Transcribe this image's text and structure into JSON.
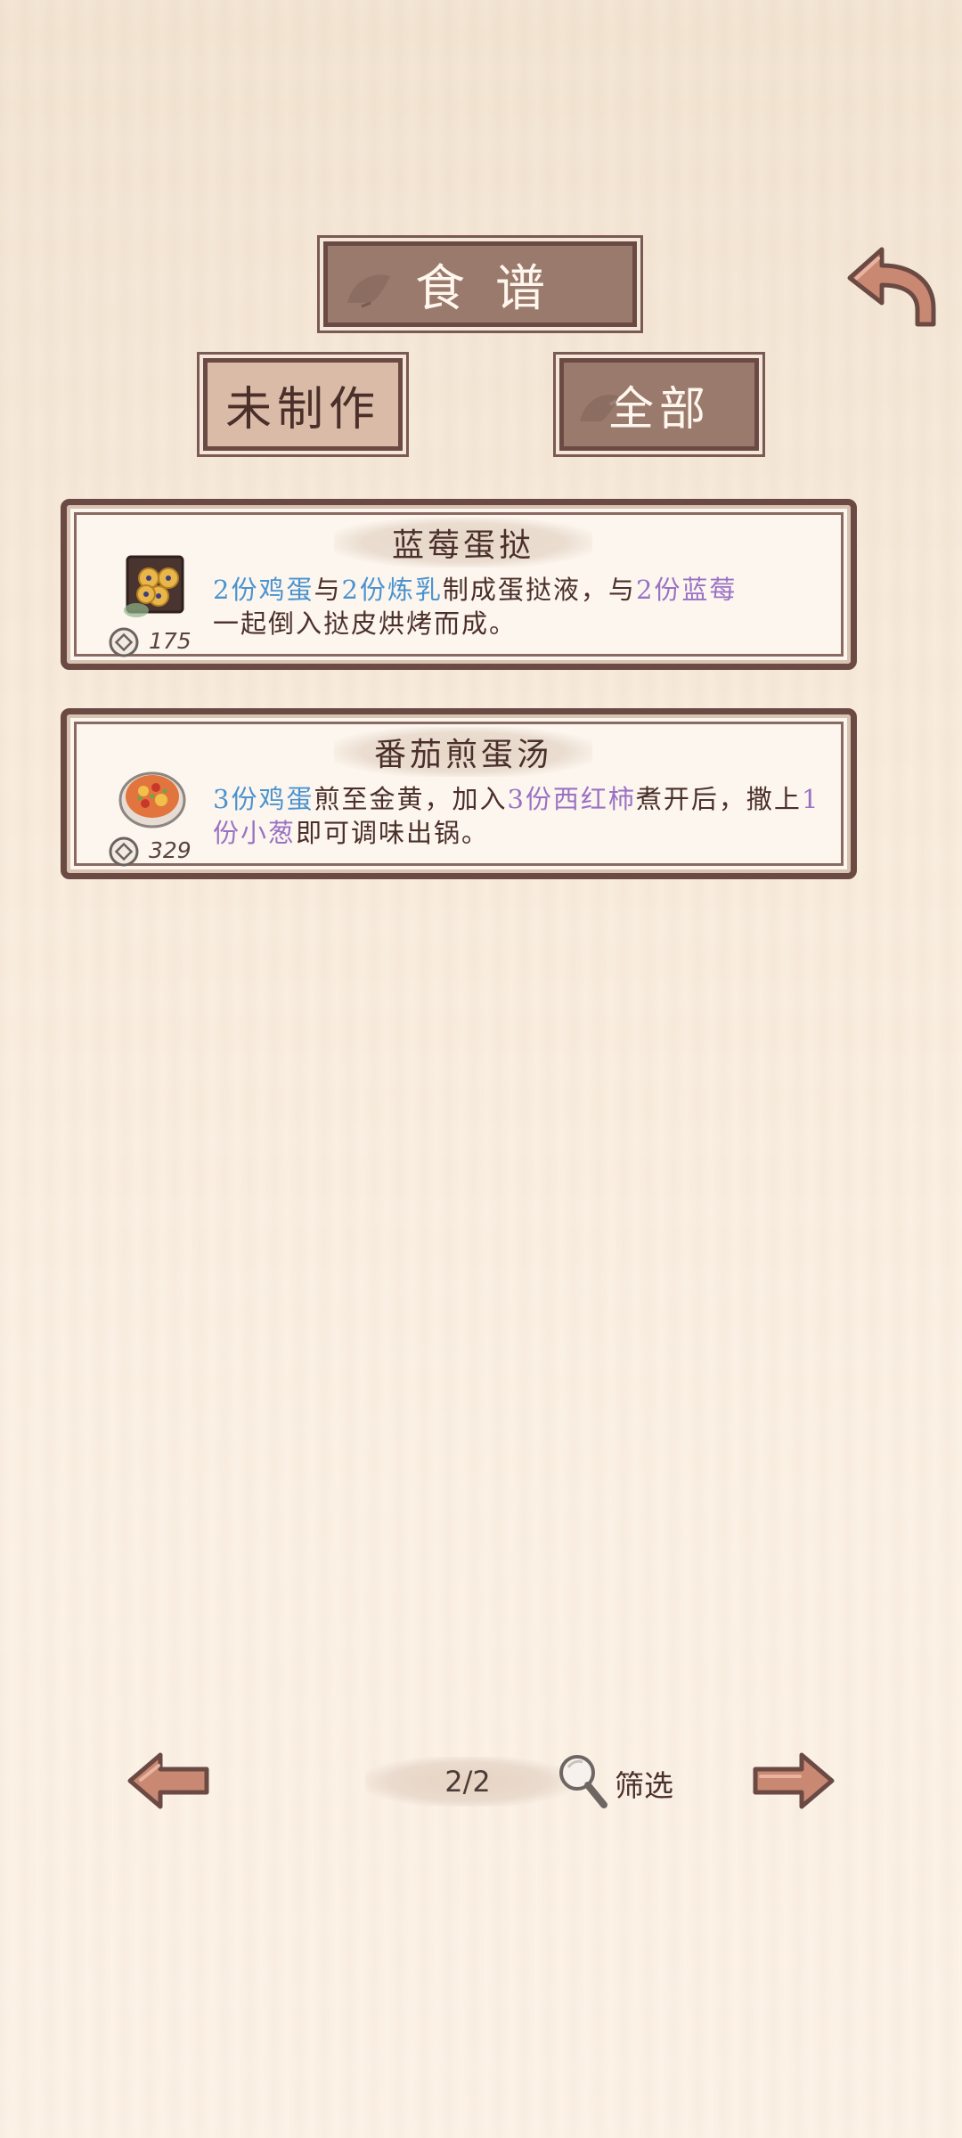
{
  "header": {
    "title": "食谱"
  },
  "tabs": [
    {
      "label": "未制作",
      "selected": false
    },
    {
      "label": "全部",
      "selected": true
    }
  ],
  "recipes": [
    {
      "name": "蓝莓蛋挞",
      "price": "175",
      "desc": [
        {
          "text": "2份鸡蛋",
          "color": "blue"
        },
        {
          "text": "与",
          "color": "plain"
        },
        {
          "text": "2份炼乳",
          "color": "blue"
        },
        {
          "text": "制成蛋挞液，与",
          "color": "plain"
        },
        {
          "text": "2份蓝莓",
          "color": "purple"
        },
        {
          "text": "一起倒入挞皮烘烤而成。",
          "color": "plain"
        }
      ]
    },
    {
      "name": "番茄煎蛋汤",
      "price": "329",
      "desc": [
        {
          "text": "3份鸡蛋",
          "color": "blue"
        },
        {
          "text": "煎至金黄，加入",
          "color": "plain"
        },
        {
          "text": "3份西红柿",
          "color": "purple"
        },
        {
          "text": "煮开后，撒上",
          "color": "plain"
        },
        {
          "text": "1份小葱",
          "color": "purple"
        },
        {
          "text": "即可调味出锅。",
          "color": "plain"
        }
      ]
    }
  ],
  "pagination": {
    "page": "2/2",
    "filter_label": "筛选"
  },
  "icons": {
    "back": "back-arrow-icon",
    "prev": "left-arrow-icon",
    "next": "right-arrow-icon",
    "search": "magnifier-icon",
    "coin": "coin-icon"
  },
  "colors": {
    "ingredient_blue": "#4b93cf",
    "ingredient_purple": "#9a72c4",
    "plaque_dark": "#9a7a6d",
    "frame": "#6b4a44"
  }
}
